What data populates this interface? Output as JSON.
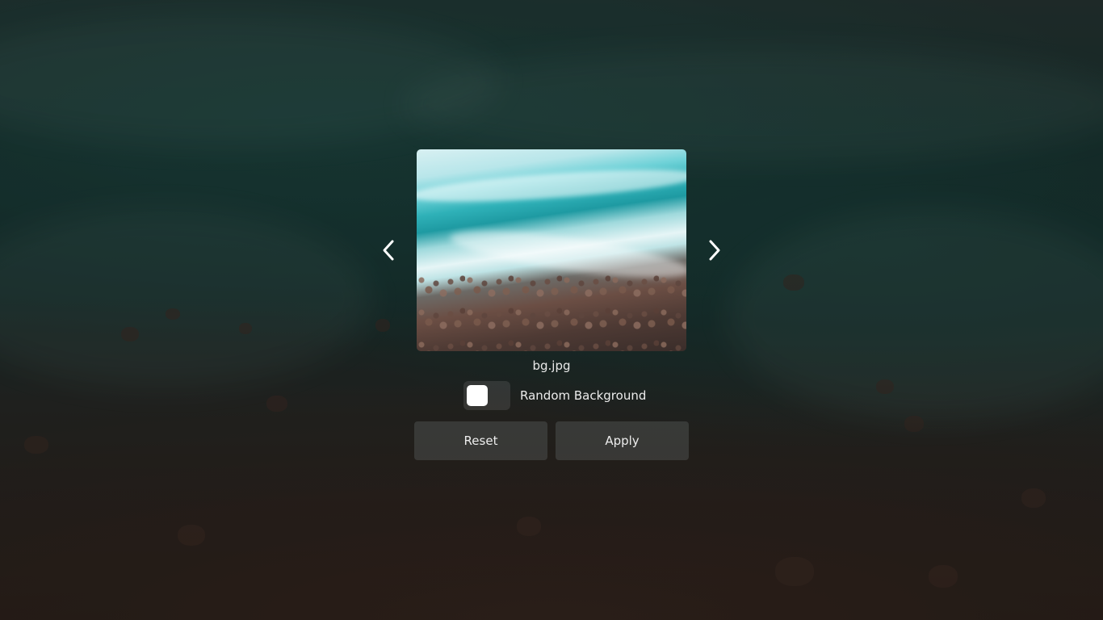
{
  "background": {
    "icon": "beach-aerial-wallpaper"
  },
  "picker": {
    "preview_icon": "wallpaper-preview-image",
    "filename": "bg.jpg",
    "prev_icon": "chevron-left-icon",
    "next_icon": "chevron-right-icon",
    "random_background": {
      "label": "Random Background",
      "checked": false
    },
    "reset_label": "Reset",
    "apply_label": "Apply"
  }
}
